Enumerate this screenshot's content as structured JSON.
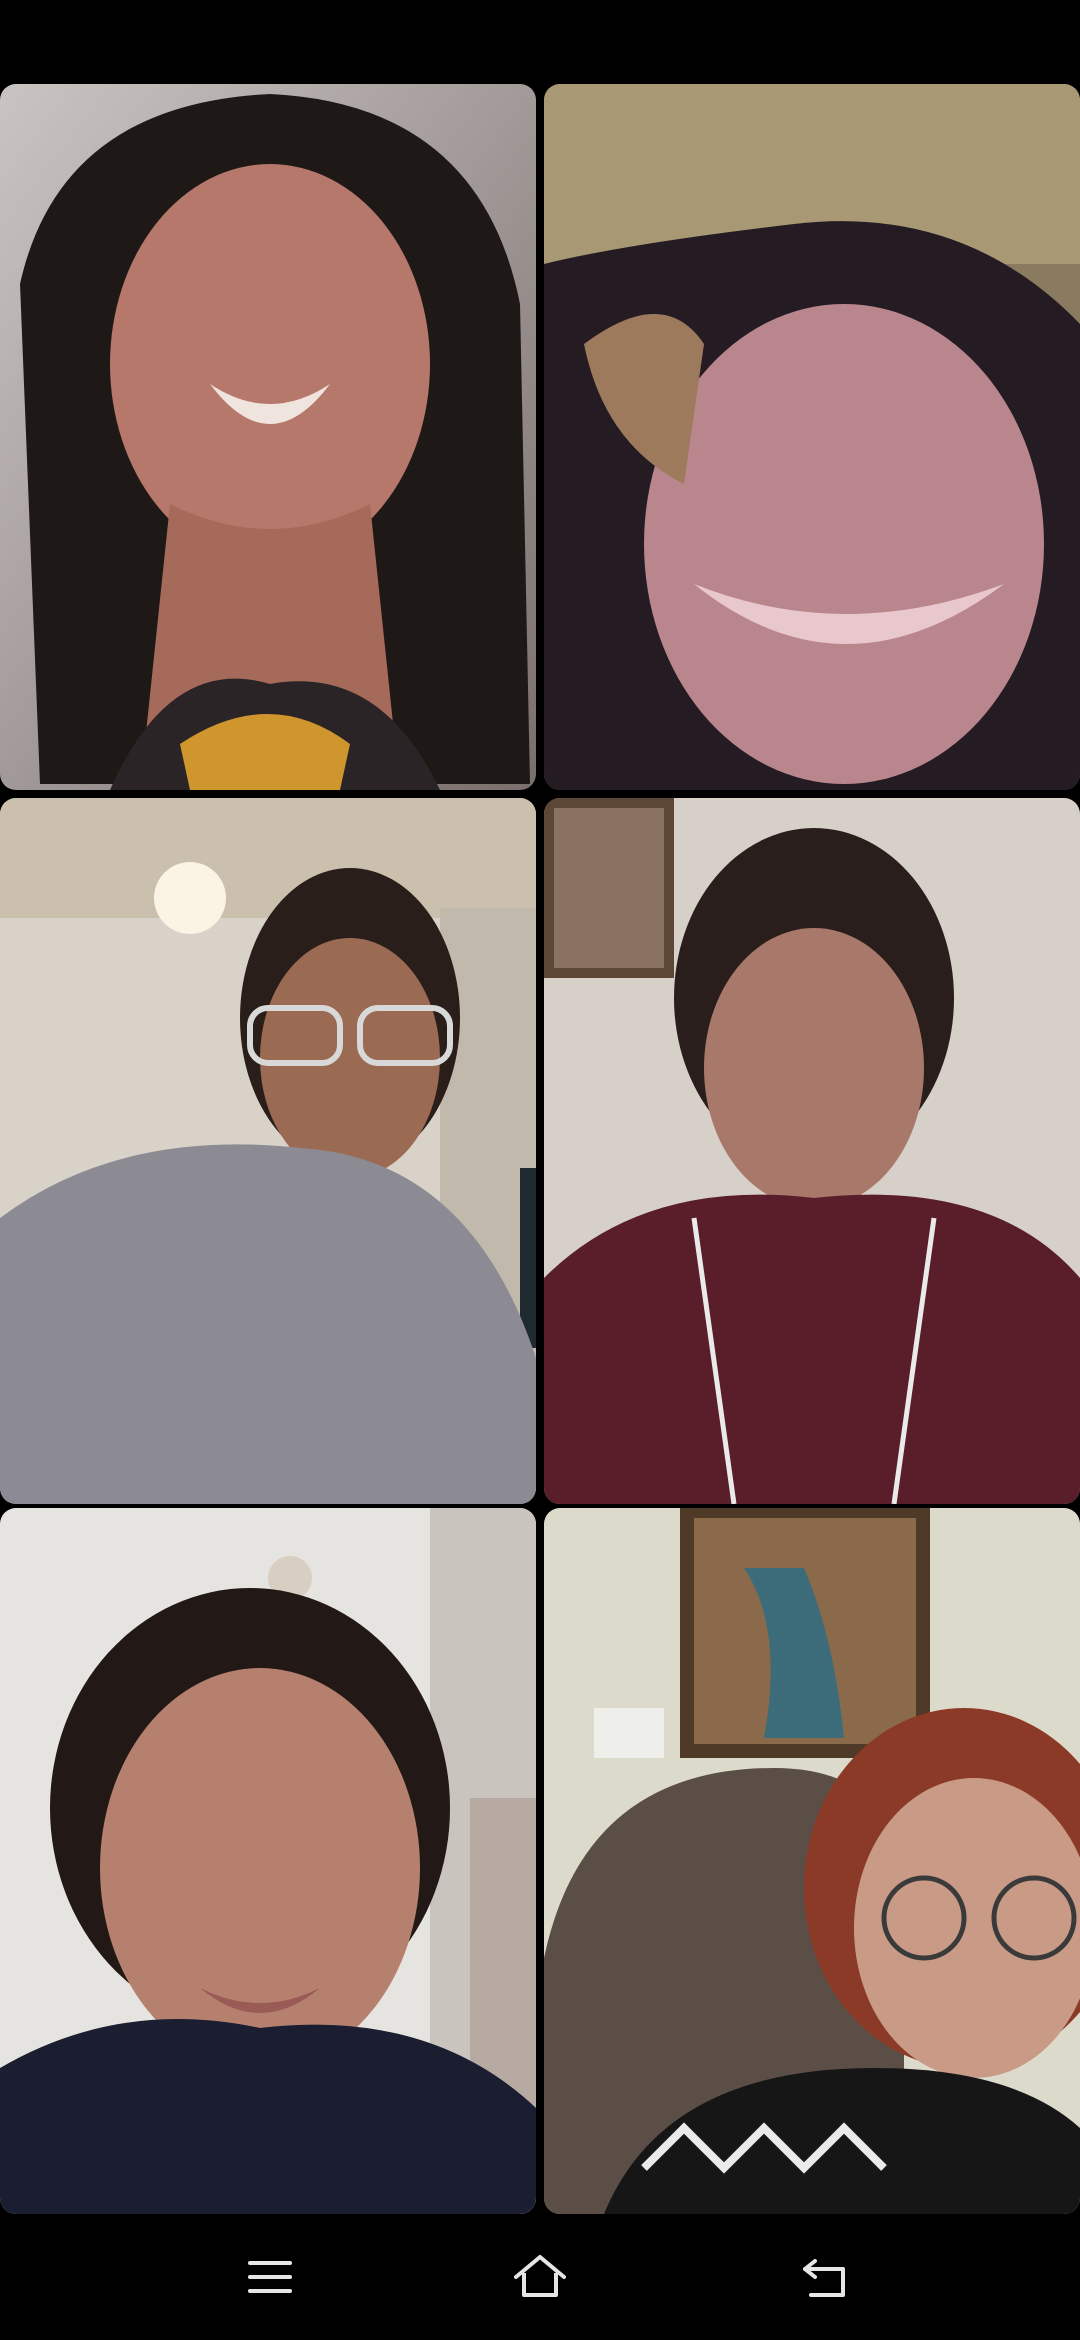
{
  "call": {
    "participants": [
      {
        "tile": 1,
        "label": ""
      },
      {
        "tile": 2,
        "label": ""
      },
      {
        "tile": 3,
        "label": ""
      },
      {
        "tile": 4,
        "label": ""
      },
      {
        "tile": 5,
        "label": ""
      },
      {
        "tile": 6,
        "label": ""
      }
    ]
  },
  "navigation": {
    "icons": [
      "menu-icon",
      "home-icon",
      "back-icon"
    ]
  },
  "colors": {
    "background": "#000000",
    "nav_icon": "#e6e6e6"
  }
}
